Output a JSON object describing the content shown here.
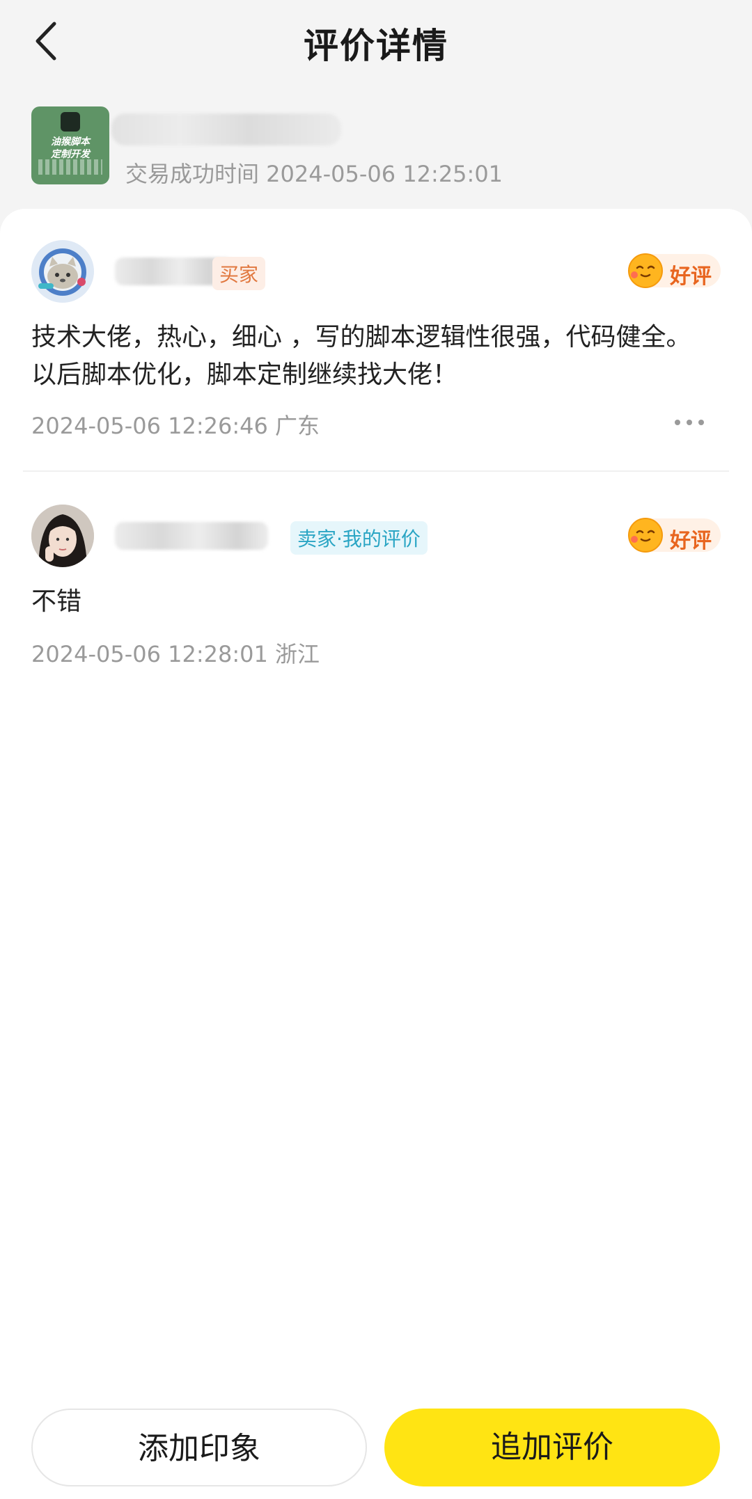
{
  "header": {
    "title": "评价详情"
  },
  "product": {
    "thumb_text": "油猴脚本\n定制开发",
    "trade_time": "交易成功时间 2024-05-06 12:25:01"
  },
  "reviews": [
    {
      "role_tag": "买家",
      "rating_label": "好评",
      "content": "技术大佬，热心，细心 ，写的脚本逻辑性很强，代码健全。 以后脚本优化，脚本定制继续找大佬！",
      "time_location": "2024-05-06 12:26:46  广东"
    },
    {
      "role_tag": "卖家·我的评价",
      "rating_label": "好评",
      "content": "不错",
      "time_location": "2024-05-06 12:28:01  浙江"
    }
  ],
  "actions": {
    "add_impression": "添加印象",
    "append_review": "追加评价"
  },
  "colors": {
    "accent_yellow": "#ffe413",
    "buyer_tag": "#e1783f",
    "seller_tag": "#2aa5c4",
    "good_review": "#e8651f"
  },
  "icons": {
    "back": "chevron-left-icon",
    "rating": "smiling-face-icon",
    "more": "more-dots-icon"
  }
}
